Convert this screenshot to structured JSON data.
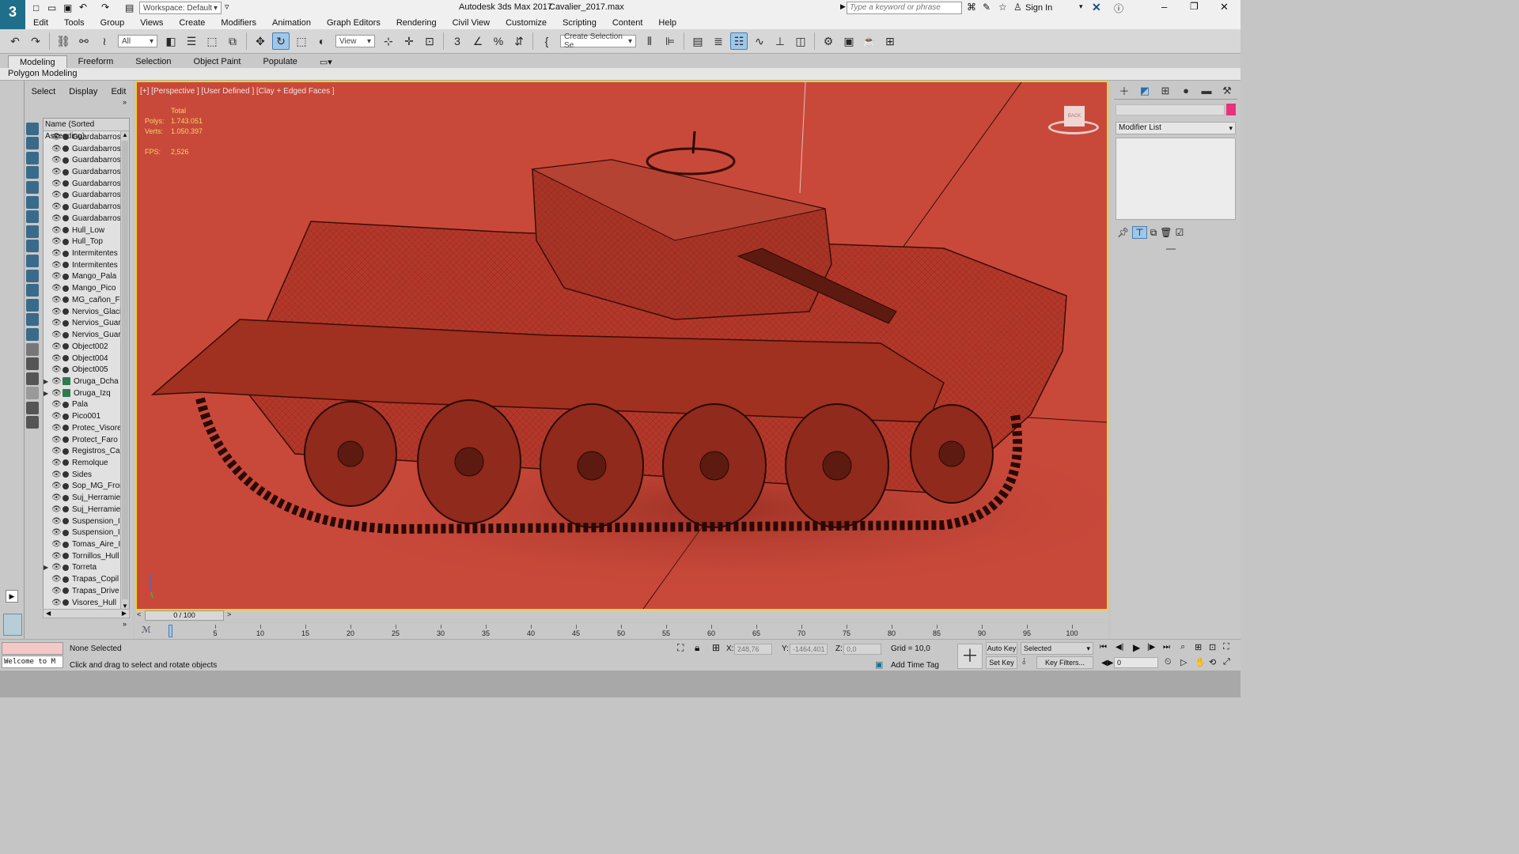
{
  "window": {
    "title": "Autodesk 3ds Max 2017",
    "file": "Cavalier_2017.max",
    "workspace": "Workspace: Default",
    "search_placeholder": "Type a keyword or phrase",
    "sign_in": "Sign In"
  },
  "menu": [
    "Edit",
    "Tools",
    "Group",
    "Views",
    "Create",
    "Modifiers",
    "Animation",
    "Graph Editors",
    "Rendering",
    "Civil View",
    "Customize",
    "Scripting",
    "Content",
    "Help"
  ],
  "toolbar": {
    "filter": "All",
    "ref_coord": "View",
    "selection_set": "Create Selection Se"
  },
  "ribbon": {
    "tabs": [
      "Modeling",
      "Freeform",
      "Selection",
      "Object Paint",
      "Populate"
    ],
    "active_tab": "Modeling",
    "sub_panel": "Polygon Modeling"
  },
  "scene_explorer": {
    "tabs": [
      "Select",
      "Display",
      "Edit"
    ],
    "column_header": "Name (Sorted Ascending)",
    "objects": [
      {
        "name": "Guardabarros",
        "group": false,
        "expand": false
      },
      {
        "name": "Guardabarros",
        "group": false,
        "expand": false
      },
      {
        "name": "Guardabarros",
        "group": false,
        "expand": false
      },
      {
        "name": "Guardabarros",
        "group": false,
        "expand": false
      },
      {
        "name": "Guardabarros",
        "group": false,
        "expand": false
      },
      {
        "name": "Guardabarros",
        "group": false,
        "expand": false
      },
      {
        "name": "Guardabarros",
        "group": false,
        "expand": false
      },
      {
        "name": "Guardabarros",
        "group": false,
        "expand": false
      },
      {
        "name": "Hull_Low",
        "group": false,
        "expand": false
      },
      {
        "name": "Hull_Top",
        "group": false,
        "expand": false
      },
      {
        "name": "Intermitentes",
        "group": false,
        "expand": false
      },
      {
        "name": "Intermitentes",
        "group": false,
        "expand": false
      },
      {
        "name": "Mango_Pala",
        "group": false,
        "expand": false
      },
      {
        "name": "Mango_Pico",
        "group": false,
        "expand": false
      },
      {
        "name": "MG_cañon_Fr",
        "group": false,
        "expand": false
      },
      {
        "name": "Nervios_Glaci",
        "group": false,
        "expand": false
      },
      {
        "name": "Nervios_Guar",
        "group": false,
        "expand": false
      },
      {
        "name": "Nervios_Guar",
        "group": false,
        "expand": false
      },
      {
        "name": "Object002",
        "group": false,
        "expand": false
      },
      {
        "name": "Object004",
        "group": false,
        "expand": false
      },
      {
        "name": "Object005",
        "group": false,
        "expand": false
      },
      {
        "name": "Oruga_Dcha",
        "group": true,
        "expand": true
      },
      {
        "name": "Oruga_Izq",
        "group": true,
        "expand": true
      },
      {
        "name": "Pala",
        "group": false,
        "expand": false
      },
      {
        "name": "Pico001",
        "group": false,
        "expand": false
      },
      {
        "name": "Protec_Visore",
        "group": false,
        "expand": false
      },
      {
        "name": "Protect_Faro",
        "group": false,
        "expand": false
      },
      {
        "name": "Registros_Ca",
        "group": false,
        "expand": false
      },
      {
        "name": "Remolque",
        "group": false,
        "expand": false
      },
      {
        "name": "Sides",
        "group": false,
        "expand": false
      },
      {
        "name": "Sop_MG_Fron",
        "group": false,
        "expand": false
      },
      {
        "name": "Suj_Herramie",
        "group": false,
        "expand": false
      },
      {
        "name": "Suj_Herramie",
        "group": false,
        "expand": false
      },
      {
        "name": "Suspension_I",
        "group": false,
        "expand": false
      },
      {
        "name": "Suspension_I",
        "group": false,
        "expand": false
      },
      {
        "name": "Tomas_Aire_I",
        "group": false,
        "expand": false
      },
      {
        "name": "Tornillos_Hull",
        "group": false,
        "expand": false
      },
      {
        "name": "Torreta",
        "group": false,
        "expand": true
      },
      {
        "name": "Trapas_Copil",
        "group": false,
        "expand": false
      },
      {
        "name": "Trapas_Drive",
        "group": false,
        "expand": false
      },
      {
        "name": "Visores_Hull",
        "group": false,
        "expand": false
      }
    ]
  },
  "viewport": {
    "label": "[+] [Perspective ] [User Defined ] [Clay + Edged Faces ]",
    "stats_total": "Total",
    "polys_label": "Polys:",
    "polys": "1.743.051",
    "verts_label": "Verts:",
    "verts": "1.050.397",
    "fps_label": "FPS:",
    "fps": "2,526",
    "viewcube_label": "BACK",
    "bg_color": "#c8493a",
    "border_color": "#f5d21e"
  },
  "command_panel": {
    "modifier_list": "Modifier List",
    "color_swatch": "#e8337a"
  },
  "timeline": {
    "frame_display": "0 / 100",
    "ticks": [
      0,
      5,
      10,
      15,
      20,
      25,
      30,
      35,
      40,
      45,
      50,
      55,
      60,
      65,
      70,
      75,
      80,
      85,
      90,
      95,
      100
    ]
  },
  "status": {
    "maxscript": "Welcome to M",
    "selection": "None Selected",
    "prompt": "Click and drag to select and rotate objects",
    "x_label": "X:",
    "x_value": "248,76",
    "y_label": "Y:",
    "y_value": "-1464,401",
    "z_label": "Z:",
    "z_value": "0,0",
    "grid": "Grid = 10,0",
    "add_time_tag": "Add Time Tag",
    "auto_key": "Auto Key",
    "set_key": "Set Key",
    "key_mode": "Selected",
    "key_filters": "Key Filters...",
    "current_frame": "0"
  }
}
